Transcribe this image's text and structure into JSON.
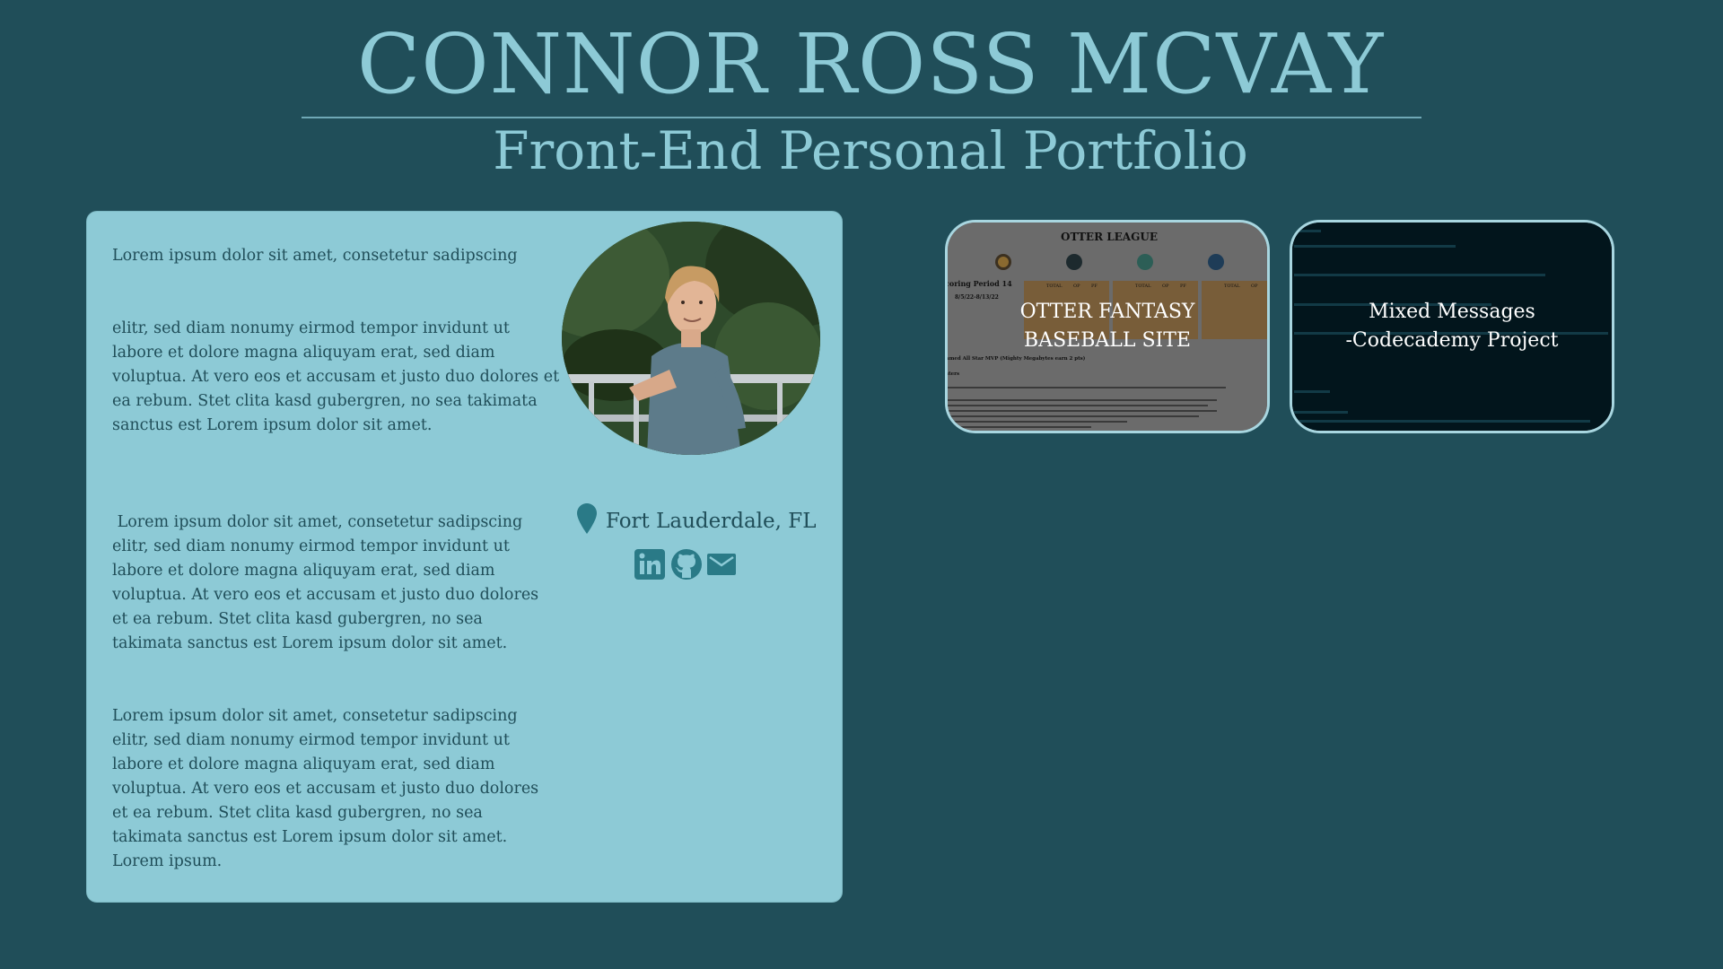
{
  "header": {
    "name": "CONNOR ROSS MCVAY",
    "subtitle": "Front-End Personal Portfolio"
  },
  "bio": {
    "paragraphs": [
      "Lorem ipsum dolor sit amet, consetetur sadipscing",
      "elitr, sed diam nonumy eirmod tempor invidunt ut labore et dolore magna aliquyam erat, sed diam voluptua. At vero eos et accusam et justo duo dolores et ea rebum. Stet clita kasd gubergren, no sea takimata sanctus est Lorem ipsum dolor sit amet.",
      " Lorem ipsum dolor sit amet, consetetur sadipscing elitr, sed diam nonumy eirmod tempor invidunt ut labore et dolore magna aliquyam erat, sed diam voluptua. At vero eos et accusam et justo duo dolores et ea rebum. Stet clita kasd gubergren, no sea takimata sanctus est Lorem ipsum dolor sit amet.",
      "Lorem ipsum dolor sit amet, consetetur sadipscing elitr, sed diam nonumy eirmod tempor invidunt ut labore et dolore magna aliquyam erat, sed diam voluptua. At vero eos et accusam et justo duo dolores et ea rebum. Stet clita kasd gubergren, no sea takimata sanctus est Lorem ipsum dolor sit amet. Lorem ipsum."
    ],
    "location": "Fort Lauderdale, FL",
    "location_icon": "map-pin-icon",
    "socials": [
      {
        "name": "LinkedIn",
        "icon": "linkedin-icon"
      },
      {
        "name": "GitHub",
        "icon": "github-icon"
      },
      {
        "name": "Email",
        "icon": "mail-icon"
      }
    ]
  },
  "projects": [
    {
      "label": "OTTER FANTASY\nBASEBALL SITE",
      "thumbnail": {
        "heading": "OTTER LEAGUE",
        "scoring": "coring Period 14",
        "dates": "8/5/22-8/13/22",
        "col_total": "TOTAL",
        "col_op": "OP",
        "col_pf": "PF",
        "mvp": "amed All Star MVP (Mighty Megabytes earn 2 pts)",
        "section": "sters"
      }
    },
    {
      "label": "Mixed Messages\n-Codecademy Project"
    }
  ],
  "colors": {
    "background": "#204e59",
    "accent": "#8dcad6",
    "text_dark": "#204e59",
    "border_light": "#a8d6e0"
  }
}
